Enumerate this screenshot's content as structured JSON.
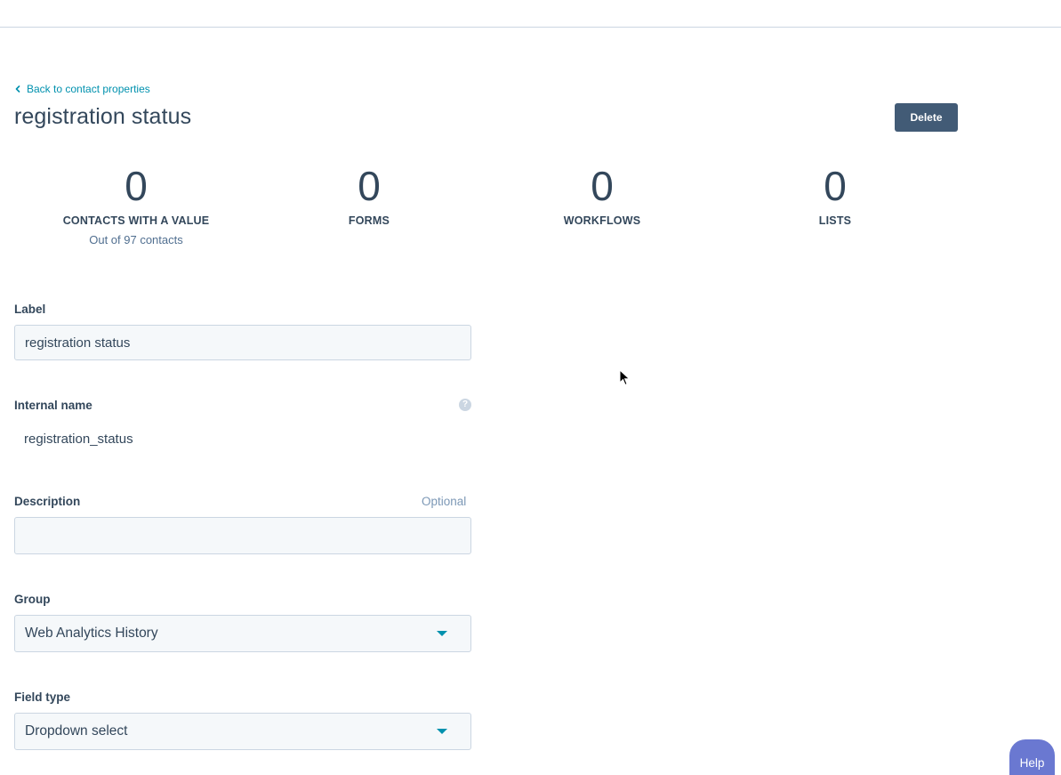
{
  "nav": {
    "back_label": "Back to contact properties"
  },
  "header": {
    "title": "registration status",
    "delete_label": "Delete"
  },
  "stats": [
    {
      "value": "0",
      "label": "CONTACTS WITH A VALUE",
      "sublabel": "Out of 97 contacts"
    },
    {
      "value": "0",
      "label": "FORMS"
    },
    {
      "value": "0",
      "label": "WORKFLOWS"
    },
    {
      "value": "0",
      "label": "LISTS"
    }
  ],
  "form": {
    "label": {
      "title": "Label",
      "value": "registration status"
    },
    "internal_name": {
      "title": "Internal name",
      "value": "registration_status"
    },
    "description": {
      "title": "Description",
      "aside": "Optional",
      "value": ""
    },
    "group": {
      "title": "Group",
      "value": "Web Analytics History"
    },
    "field_type": {
      "title": "Field type",
      "value": "Dropdown select"
    }
  },
  "help_widget": {
    "label": "Help"
  },
  "colors": {
    "link": "#0091ae",
    "primary_button": "#425b76",
    "help": "#6a78d1",
    "text": "#33475b"
  }
}
